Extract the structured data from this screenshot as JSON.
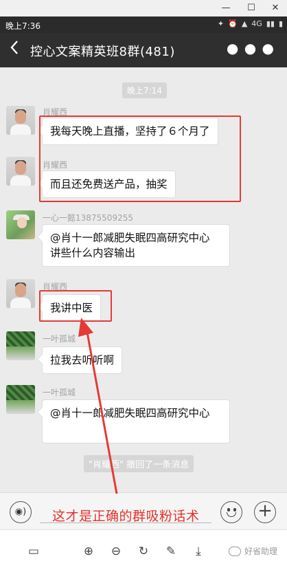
{
  "window": {
    "minimize": "—",
    "maximize": "☐",
    "close": "✕"
  },
  "status": {
    "time": "晚上7:36",
    "icons": [
      "✉",
      "✦",
      "⏰",
      "▲",
      "4G",
      "▮▮",
      "▮"
    ]
  },
  "header": {
    "title": "控心文案精英班8群(481)"
  },
  "chat": {
    "timestamp": "晚上7:14",
    "messages": [
      {
        "sender": "肖耀西",
        "text": "我每天晚上直播，坚持了６个月了",
        "avatar": "man"
      },
      {
        "sender": "肖耀西",
        "text": "而且还免费送产品，抽奖",
        "avatar": "man"
      },
      {
        "sender": "一心一懿13875509255",
        "text": "@肖十一郎减肥失眠四高研究中心 讲些什么内容输出",
        "avatar": "girl"
      },
      {
        "sender": "肖耀西",
        "text": "我讲中医",
        "avatar": "man"
      },
      {
        "sender": "一叶孤城",
        "text": "拉我去听听啊",
        "avatar": "nature"
      },
      {
        "sender": "一叶孤城",
        "text": "@肖十一郎减肥失眠四高研究中心",
        "avatar": "nature"
      }
    ],
    "recall_notice": "\"肖耀西\" 撤回了一条消息"
  },
  "overlay": {
    "caption": "这才是正确的群吸粉话术",
    "color": "#e5322b"
  },
  "brand": {
    "name": "好省助理"
  },
  "colors": {
    "header_bg": "#2f2f2f",
    "chat_bg": "#ebebeb",
    "annotation_red": "#e53a34"
  }
}
